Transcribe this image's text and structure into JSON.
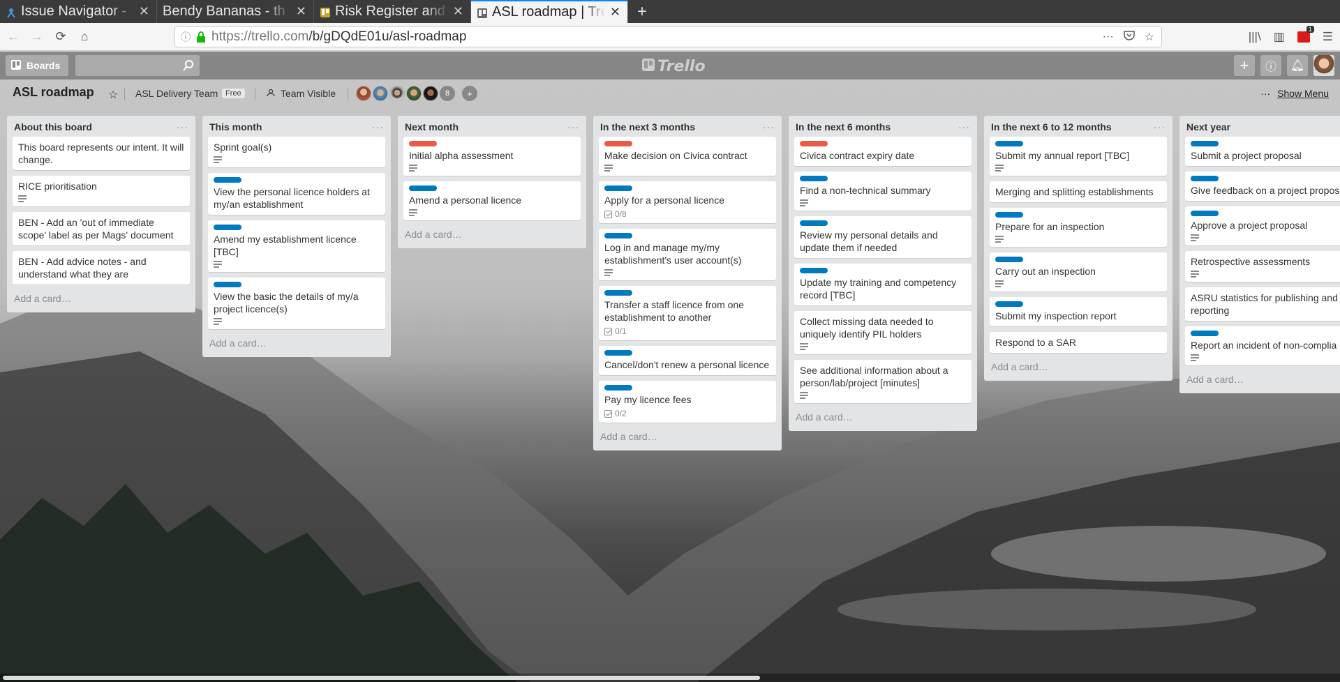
{
  "browser": {
    "tabs": [
      {
        "title": "Issue Navigator - ",
        "active": false
      },
      {
        "title": "Bendy Bananas - th",
        "active": false
      },
      {
        "title": "Risk Register and ",
        "active": false
      },
      {
        "title": "ASL roadmap | Tre",
        "active": true
      }
    ],
    "url_host": "https://trello.com",
    "url_path": "/b/gDQdE01u/asl-roadmap",
    "ext_badge_count": "1"
  },
  "header": {
    "boards_label": "Boards",
    "logo_text": "Trello"
  },
  "board": {
    "title": "ASL roadmap",
    "team": "ASL Delivery Team",
    "team_plan": "Free",
    "visibility": "Team Visible",
    "member_overflow": "8",
    "show_menu": "Show Menu"
  },
  "add_card_label": "Add a card…",
  "colors": {
    "blue_label": "#0079bf",
    "red_label": "#eb5a46",
    "list_bg": "#e2e4e6"
  },
  "lists": [
    {
      "title": "About this board",
      "cards": [
        {
          "title": "This board represents our intent. It will change.",
          "label": null,
          "desc": false,
          "check": null
        },
        {
          "title": "RICE prioritisation",
          "label": null,
          "desc": true,
          "check": null
        },
        {
          "title": "BEN - Add an 'out of immediate scope' label as per Mags' document",
          "label": null,
          "desc": false,
          "check": null
        },
        {
          "title": "BEN - Add advice notes - and understand what they are",
          "label": null,
          "desc": false,
          "check": null
        }
      ]
    },
    {
      "title": "This month",
      "cards": [
        {
          "title": "Sprint goal(s)",
          "label": null,
          "desc": true,
          "check": null
        },
        {
          "title": "View the personal licence holders at my/an establishment",
          "label": "blue",
          "desc": false,
          "check": null
        },
        {
          "title": "Amend my establishment licence [TBC]",
          "label": "blue",
          "desc": true,
          "check": null
        },
        {
          "title": "View the basic the details of my/a project licence(s)",
          "label": "blue",
          "desc": true,
          "check": null
        }
      ]
    },
    {
      "title": "Next month",
      "cards": [
        {
          "title": "Initial alpha assessment",
          "label": "red",
          "desc": true,
          "check": null
        },
        {
          "title": "Amend a personal licence",
          "label": "blue",
          "desc": true,
          "check": null
        }
      ]
    },
    {
      "title": "In the next 3 months",
      "cards": [
        {
          "title": "Make decision on Civica contract",
          "label": "red",
          "desc": true,
          "check": null
        },
        {
          "title": "Apply for a personal licence",
          "label": "blue",
          "desc": false,
          "check": "0/8"
        },
        {
          "title": "Log in and manage my/my establishment's user account(s)",
          "label": "blue",
          "desc": true,
          "check": null
        },
        {
          "title": "Transfer a staff licence from one establishment to another",
          "label": "blue",
          "desc": false,
          "check": "0/1"
        },
        {
          "title": "Cancel/don't renew a personal licence",
          "label": "blue",
          "desc": false,
          "check": null
        },
        {
          "title": "Pay my licence fees",
          "label": "blue",
          "desc": false,
          "check": "0/2"
        }
      ]
    },
    {
      "title": "In the next 6 months",
      "cards": [
        {
          "title": "Civica contract expiry date",
          "label": "red",
          "desc": false,
          "check": null
        },
        {
          "title": "Find a non-technical summary",
          "label": "blue",
          "desc": true,
          "check": null
        },
        {
          "title": "Review my personal details and update them if needed",
          "label": "blue",
          "desc": false,
          "check": null
        },
        {
          "title": "Update my training and competency record [TBC]",
          "label": "blue",
          "desc": false,
          "check": null
        },
        {
          "title": "Collect missing data needed to uniquely identify PIL holders",
          "label": null,
          "desc": true,
          "check": null
        },
        {
          "title": "See additional information about a person/lab/project [minutes]",
          "label": null,
          "desc": true,
          "check": null
        }
      ]
    },
    {
      "title": "In the next 6 to 12 months",
      "cards": [
        {
          "title": "Submit my annual report [TBC]",
          "label": "blue",
          "desc": true,
          "check": null
        },
        {
          "title": "Merging and splitting establishments",
          "label": null,
          "desc": false,
          "check": null
        },
        {
          "title": "Prepare for an inspection",
          "label": "blue",
          "desc": true,
          "check": null
        },
        {
          "title": "Carry out an inspection",
          "label": "blue",
          "desc": true,
          "check": null
        },
        {
          "title": "Submit my inspection report",
          "label": "blue",
          "desc": false,
          "check": null
        },
        {
          "title": "Respond to a SAR",
          "label": null,
          "desc": false,
          "check": null
        }
      ]
    },
    {
      "title": "Next year",
      "cards": [
        {
          "title": "Submit a project proposal",
          "label": "blue",
          "desc": false,
          "check": null
        },
        {
          "title": "Give feedback on a project propos",
          "label": "blue",
          "desc": false,
          "check": null
        },
        {
          "title": "Approve a project proposal",
          "label": "blue",
          "desc": true,
          "check": null
        },
        {
          "title": "Retrospective assessments",
          "label": null,
          "desc": true,
          "check": null
        },
        {
          "title": "ASRU statistics for publishing and reporting",
          "label": null,
          "desc": false,
          "check": null
        },
        {
          "title": "Report an incident of non-complia",
          "label": "blue",
          "desc": true,
          "check": null
        }
      ]
    }
  ]
}
